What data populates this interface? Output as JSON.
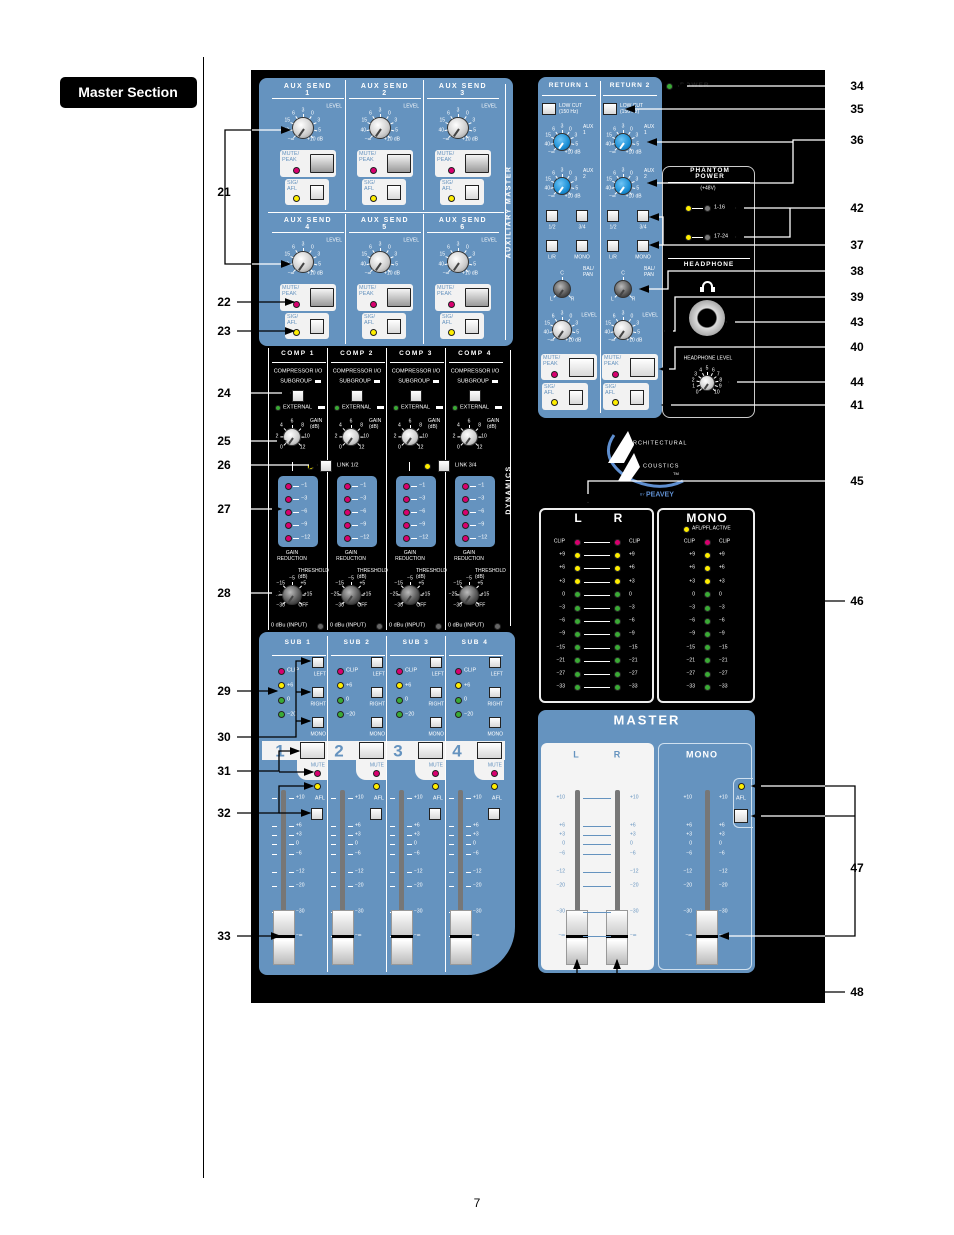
{
  "page": {
    "section_tab": "Master Section",
    "page_number": "7"
  },
  "callouts": {
    "left": [
      "21",
      "22",
      "23",
      "24",
      "25",
      "26",
      "27",
      "28",
      "29",
      "30",
      "31",
      "32",
      "33"
    ],
    "right": [
      "34",
      "35",
      "36",
      "42",
      "37",
      "38",
      "39",
      "43",
      "40",
      "44",
      "41",
      "45",
      "46",
      "47",
      "48"
    ]
  },
  "aux_master": {
    "title": "AUXILIARY MASTER",
    "level_label": "LEVEL",
    "mute_peak_label": "MUTE/ PEAK",
    "sig_afl_label": "SIG/ AFL",
    "sends": [
      "AUX SEND 1",
      "AUX SEND 2",
      "AUX SEND 3",
      "AUX SEND 4",
      "AUX SEND 5",
      "AUX SEND 6"
    ]
  },
  "knob_scales": {
    "level": [
      "−∞",
      "40",
      "15",
      "6",
      "3",
      "0",
      "3",
      "5",
      "+10 dB"
    ],
    "pan": [
      "L",
      "C",
      "R"
    ],
    "gain": [
      "0",
      "2",
      "4",
      "6",
      "8",
      "10",
      "12"
    ],
    "threshold": [
      "−30",
      "−25",
      "−15",
      "−5",
      "+5",
      "+15",
      "OFF"
    ],
    "headphone": [
      "0",
      "1",
      "2",
      "3",
      "4",
      "5",
      "6",
      "7",
      "8",
      "9",
      "10"
    ]
  },
  "dynamics": {
    "title": "DYNAMICS",
    "channels": [
      "COMP 1",
      "COMP 2",
      "COMP 3",
      "COMP 4"
    ],
    "compressor_io": "COMPRESSOR I/O",
    "subgroup": "SUBGROUP",
    "external": "EXTERNAL",
    "gain_label": "GAIN (dB)",
    "gr_values": [
      "−1",
      "−3",
      "−6",
      "−9",
      "−12"
    ],
    "gain_reduction": "GAIN REDUCTION",
    "threshold_label": "THRESHOLD (dB)",
    "input_label": "0 dBu (INPUT)",
    "links": [
      "LINK 1/2",
      "LINK 3/4"
    ]
  },
  "subgroups": {
    "channels": [
      {
        "title": "SUB 1",
        "number": "1"
      },
      {
        "title": "SUB 2",
        "number": "2"
      },
      {
        "title": "SUB 3",
        "number": "3"
      },
      {
        "title": "SUB 4",
        "number": "4"
      }
    ],
    "meter": [
      "CLIP",
      "+6",
      "0",
      "−20"
    ],
    "assign": [
      "LEFT",
      "RIGHT",
      "MONO"
    ],
    "mute": "MUTE",
    "afl": "AFL",
    "fader_scale": [
      "+10",
      "+6",
      "+3",
      "0",
      "−6",
      "−12",
      "−20",
      "−30",
      "−∞"
    ]
  },
  "returns": {
    "channels": [
      "RETURN 1",
      "RETURN 2"
    ],
    "low_cut": "LOW CUT (150 Hz)",
    "aux_labels": [
      "AUX 1",
      "AUX 2"
    ],
    "assign": [
      "1/2",
      "3/4",
      "L/R",
      "MONO"
    ],
    "bal_pan": "BAL/ PAN",
    "level": "LEVEL",
    "mute_peak": "MUTE/ PEAK",
    "sig_afl": "SIG/ AFL"
  },
  "power": {
    "label": "POWER"
  },
  "phantom": {
    "title": "PHANTOM POWER",
    "voltage": "(+48V)",
    "groups": [
      "1-16",
      "17-24"
    ]
  },
  "headphone": {
    "title": "HEADPHONE",
    "level_label": "HEADPHONE LEVEL",
    "icon": "headphones-icon"
  },
  "logo": {
    "line1": "RCHITECTURAL",
    "line2": "COUSTICS",
    "tm": "TM",
    "by": "BY",
    "brand": "PEAVEY"
  },
  "meters": {
    "lr_labels": [
      "L",
      "R"
    ],
    "mono_title": "MONO",
    "afl_pfl_active": "AFL/PFL ACTIVE",
    "scale": [
      "CLIP",
      "+9",
      "+6",
      "+3",
      "0",
      "−3",
      "−6",
      "−9",
      "−15",
      "−21",
      "−27",
      "−33"
    ]
  },
  "master": {
    "title": "MASTER",
    "lr": [
      "L",
      "R"
    ],
    "mono": "MONO",
    "afl": "AFL",
    "fader_scale": [
      "+10",
      "+6",
      "+3",
      "0",
      "−6",
      "−12",
      "−20",
      "−30",
      "−∞"
    ]
  },
  "colors": {
    "panel_blue": "#6593bf",
    "led_clip": "#d8006f",
    "led_yellow": "#ffee00",
    "led_green": "#3aaa35",
    "knob_blue": "#1a8fd6"
  }
}
